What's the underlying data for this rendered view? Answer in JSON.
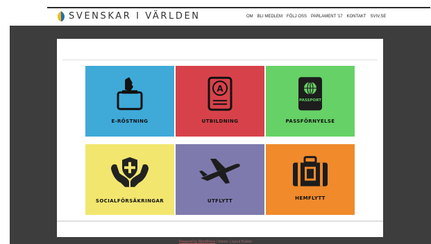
{
  "brand": {
    "name": "SVENSKAR I VÄRLDEN"
  },
  "nav": {
    "items": [
      "OM",
      "BLI MEDLEM",
      "FÖLJ OSS",
      "PARLAMENT '17",
      "KONTAKT",
      "SVIV.SE"
    ]
  },
  "tiles": [
    {
      "label": "E-RÖSTNING",
      "color": "#3fa9d8",
      "icon": "ballot-box-icon"
    },
    {
      "label": "UTBILDNING",
      "color": "#d7424a",
      "icon": "certificate-icon"
    },
    {
      "label": "PASSFÖRNYELSE",
      "color": "#66d166",
      "icon": "passport-icon"
    },
    {
      "label": "SOCIALFÖRSÄKRINGAR",
      "color": "#f2e66e",
      "icon": "shield-hands-icon"
    },
    {
      "label": "UTFLYTT",
      "color": "#7f7aad",
      "icon": "airplane-icon"
    },
    {
      "label": "HEMFLYTT",
      "color": "#f08a2b",
      "icon": "suitcase-icon"
    }
  ],
  "passport_icon_text": "PASSPORT",
  "footer": {
    "powered": "Powered by WordPress",
    "theme": "| theme: Layout Builder"
  }
}
